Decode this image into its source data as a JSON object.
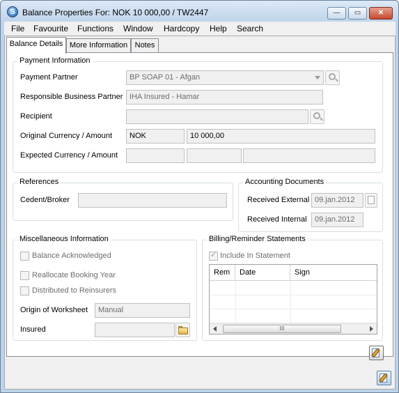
{
  "window": {
    "title": "Balance Properties For: NOK 10 000,00 / TW2447",
    "app_icon_glyph": "S",
    "controls": {
      "minimize": "—",
      "maximize": "▭",
      "close": "✕"
    }
  },
  "menu": [
    "File",
    "Favourite",
    "Functions",
    "Window",
    "Hardcopy",
    "Help",
    "Search"
  ],
  "tabs": [
    "Balance Details",
    "More Information",
    "Notes"
  ],
  "payment_info": {
    "legend": "Payment Information",
    "payment_partner_label": "Payment Partner",
    "payment_partner_value": "BP SOAP 01 - Afgan",
    "responsible_label": "Responsible Business Partner",
    "responsible_value": "IHA Insured - Hamar",
    "recipient_label": "Recipient",
    "recipient_value": "",
    "orig_label": "Original Currency / Amount",
    "orig_currency": "NOK",
    "orig_amount": "10 000,00",
    "expected_label": "Expected Currency / Amount",
    "expected_currency": "",
    "expected_amount": "",
    "expected_extra": ""
  },
  "references": {
    "legend": "References",
    "cedent_label": "Cedent/Broker",
    "cedent_value": ""
  },
  "accounting": {
    "legend": "Accounting Documents",
    "received_external_label": "Received External",
    "received_external_value": "09.jan.2012",
    "received_internal_label": "Received Internal",
    "received_internal_value": "09.jan.2012"
  },
  "misc": {
    "legend": "Miscellaneous Information",
    "balance_ack": "Balance Acknowledged",
    "reallocate": "Reallocate Booking Year",
    "distributed": "Distributed to Reinsurers",
    "origin_label": "Origin of Worksheet",
    "origin_value": "Manual",
    "insured_label": "Insured",
    "insured_value": ""
  },
  "billing": {
    "legend": "Billing/Reminder Statements",
    "include_label": "Include In Statement",
    "include_checked": true,
    "columns": [
      "Rem",
      "Date",
      "Sign"
    ],
    "scroll_thumb_glyph": "III"
  },
  "icons": {
    "window_icon": "app-logo-icon",
    "search": "magnifier-icon",
    "calendar": "calendar-icon",
    "folder": "folder-open-icon",
    "edit": "edit-document-icon"
  }
}
